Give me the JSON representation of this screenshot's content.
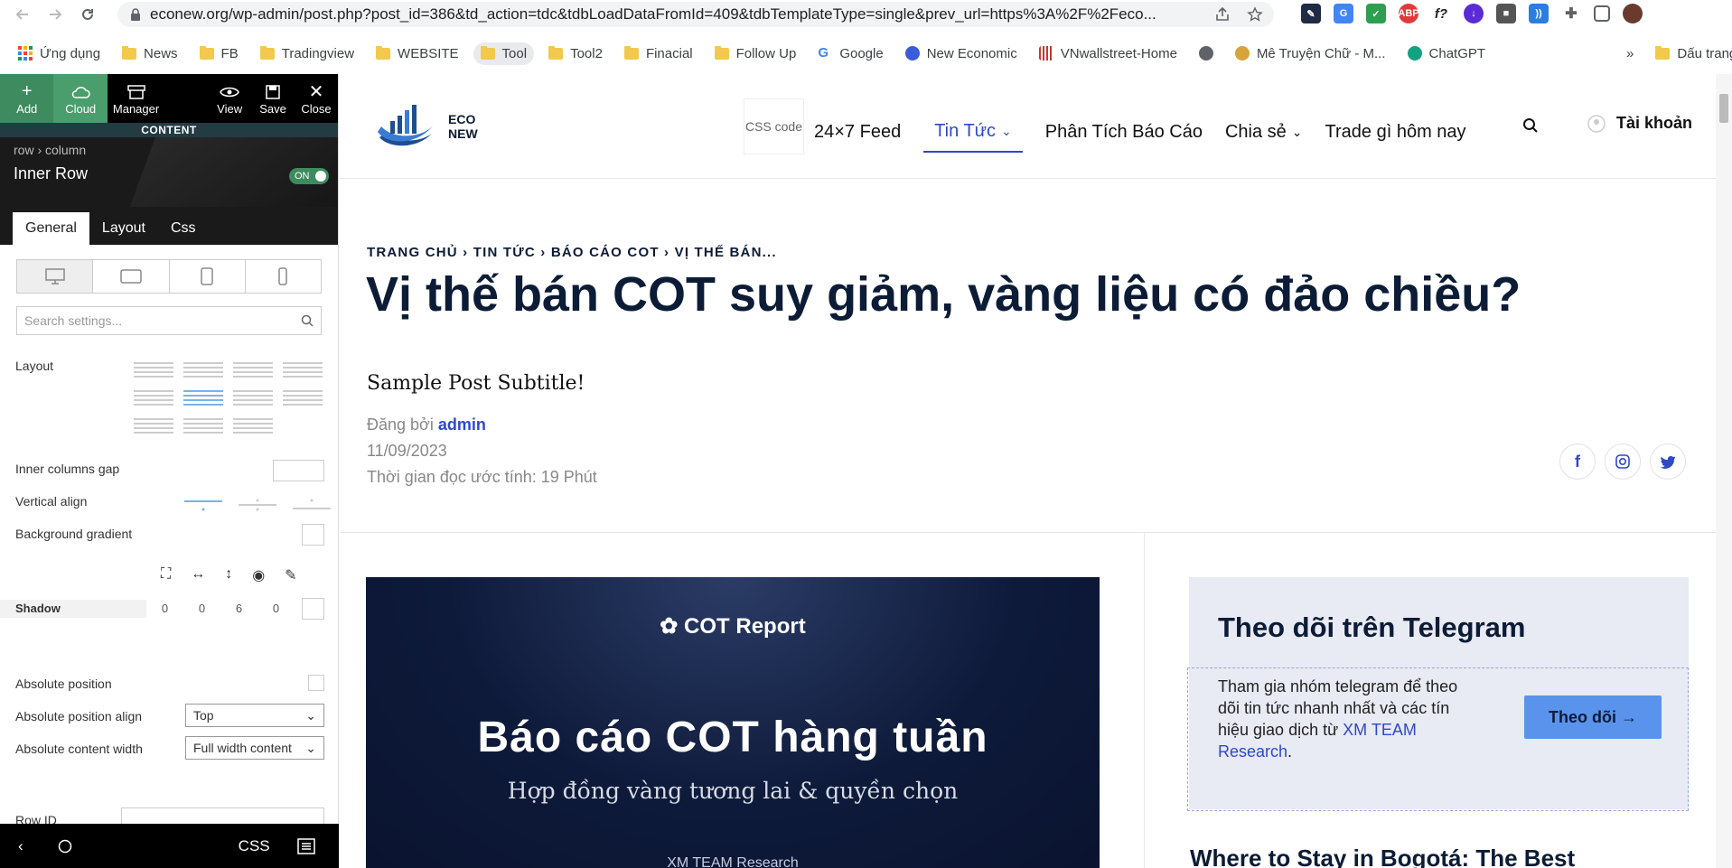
{
  "browser": {
    "url": "econew.org/wp-admin/post.php?post_id=386&td_action=tdc&tdbLoadDataFromId=409&tdbTemplateType=single&prev_url=https%3A%2F%2Feco...",
    "bookmarks": [
      "Ứng dụng",
      "News",
      "FB",
      "Tradingview",
      "WEBSITE",
      "Tool",
      "Tool2",
      "Finacial",
      "Follow Up",
      "Google",
      "New Economic",
      "VNwallstreet-Home",
      "",
      "Mê Truyện Chữ - M...",
      "ChatGPT"
    ],
    "more": "»",
    "other_bookmarks": "Dấu trang khác"
  },
  "editor": {
    "toolbar": {
      "add": "Add",
      "cloud": "Cloud",
      "manager": "Manager",
      "view": "View",
      "save": "Save",
      "close": "Close"
    },
    "content_label": "CONTENT",
    "crumb": "row › column",
    "element_title": "Inner Row",
    "toggle": "ON",
    "tabs": [
      "General",
      "Layout",
      "Css"
    ],
    "search_placeholder": "Search settings...",
    "labels": {
      "layout": "Layout",
      "inner_gap": "Inner columns gap",
      "valign": "Vertical align",
      "bg_gradient": "Background gradient",
      "shadow": "Shadow",
      "abs_pos": "Absolute position",
      "abs_align": "Absolute position align",
      "abs_width": "Absolute content width",
      "row_id": "Row ID"
    },
    "shadow_values": [
      "0",
      "0",
      "6",
      "0"
    ],
    "abs_align_value": "Top",
    "abs_width_value": "Full width content",
    "bottom_css": "CSS"
  },
  "site": {
    "logo": {
      "line1": "ECO",
      "line2": "NEW"
    },
    "css_code": "CSS code",
    "nav": [
      "24×7 Feed",
      "Tin Tức",
      "Phân Tích Báo Cáo",
      "Chia sẻ",
      "Trade gì hôm nay"
    ],
    "account": "Tài khoản",
    "breadcrumb": "TRANG CHỦ › TIN TỨC › BÁO CÁO COT › VỊ THẾ BÁN...",
    "title": "Vị thế bán COT suy giảm, vàng liệu có đảo chiều?",
    "subtitle": "Sample Post Subtitle!",
    "by_label": "Đăng bởi",
    "author": "admin",
    "date": "11/09/2023",
    "read_time": "Thời gian đọc ước tính: 19 Phút",
    "feature": {
      "brand": "COT Report",
      "headline": "Báo cáo COT hàng tuần",
      "sub": "Hợp đồng vàng tương lai & quyền chọn",
      "footer": "XM TEAM Research"
    },
    "telegram": {
      "title": "Theo dõi trên Telegram",
      "text": "Tham gia nhóm telegram để theo dõi tin tức nhanh nhất và các tín hiệu giao dịch từ",
      "link": "XM TEAM Research",
      "end": ".",
      "button": "Theo dõi →"
    },
    "next_post": "Where to Stay in Bogotá: The Best"
  }
}
